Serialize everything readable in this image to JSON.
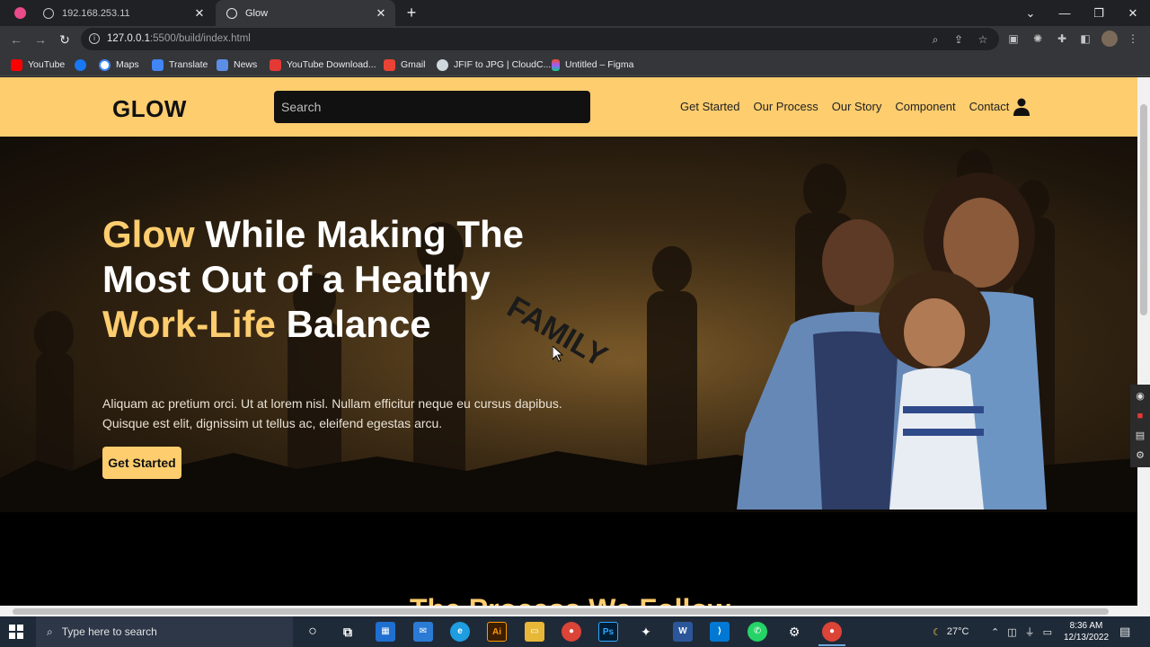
{
  "browser": {
    "tabs": [
      {
        "title": "192.168.253.11",
        "active": false
      },
      {
        "title": "Glow",
        "active": true
      }
    ],
    "url_host": "127.0.0.1",
    "url_path": ":5500/build/index.html",
    "bookmarks": [
      "YouTube",
      "Maps",
      "Translate",
      "News",
      "YouTube Download...",
      "Gmail",
      "JFIF to JPG | CloudC...",
      "Untitled – Figma"
    ]
  },
  "site": {
    "logo": "GLOW",
    "search_placeholder": "Search",
    "nav": [
      "Get Started",
      "Our Process",
      "Our Story",
      "Component",
      "Contact"
    ],
    "hero": {
      "title_accent_1": "Glow",
      "title_rest_1": " While Making The Most Out of a Healthy ",
      "title_accent_2": "Work-Life",
      "title_rest_2": " Balance",
      "subtitle": "Aliquam ac pretium orci. Ut at lorem nisl. Nullam efficitur neque eu cursus dapibus. Quisque est elit, dignissim ut tellus ac, eleifend egestas arcu.",
      "cta": "Get Started",
      "balloon_text": "FAMILY"
    },
    "next_section_title": "The Process We Follow"
  },
  "taskbar": {
    "search_placeholder": "Type here to search",
    "temperature": "27°C",
    "time": "8:36 AM",
    "date": "12/13/2022"
  },
  "colors": {
    "accent": "#fdcd6e",
    "header_bg": "#fdcd6e",
    "search_bg": "#111111",
    "hero_text": "#ffffff"
  }
}
